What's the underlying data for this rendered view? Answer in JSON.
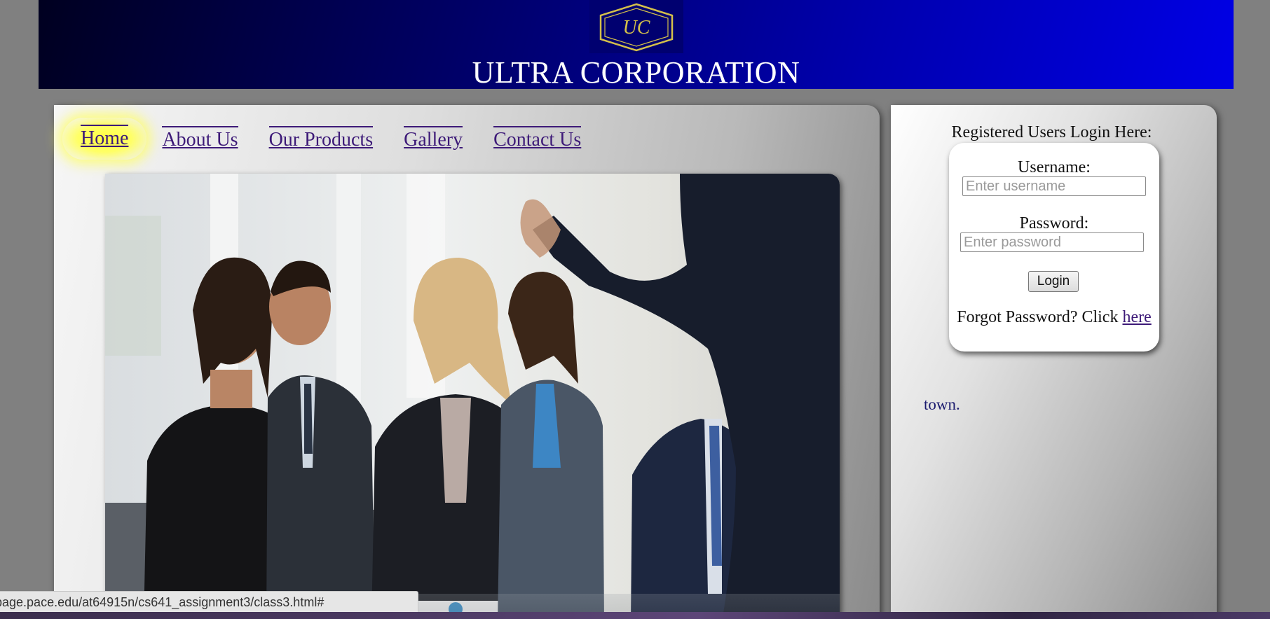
{
  "header": {
    "logo_text": "UC",
    "title": "ULTRA CORPORATION"
  },
  "nav": {
    "items": [
      {
        "label": "Home",
        "active": true
      },
      {
        "label": "About Us",
        "active": false
      },
      {
        "label": "Our Products",
        "active": false
      },
      {
        "label": "Gallery",
        "active": false
      },
      {
        "label": "Contact Us",
        "active": false
      }
    ]
  },
  "hero": {
    "image_semantic": "business-meeting-photo"
  },
  "login": {
    "heading": "Registered Users Login Here:",
    "username_label": "Username:",
    "username_placeholder": "Enter username",
    "username_value": "",
    "password_label": "Password:",
    "password_placeholder": "Enter password",
    "password_value": "",
    "button_label": "Login",
    "forgot_text": "Forgot Password? Click ",
    "forgot_link": "here"
  },
  "sidebar": {
    "text": "town."
  },
  "status_bar": {
    "url": "page.pace.edu/at64915n/cs641_assignment3/class3.html#"
  },
  "colors": {
    "background": "#808080",
    "header_dark": "#000020",
    "header_bright": "#0000e6",
    "nav_link": "#3d1a78",
    "active_highlight": "#ffff40"
  }
}
